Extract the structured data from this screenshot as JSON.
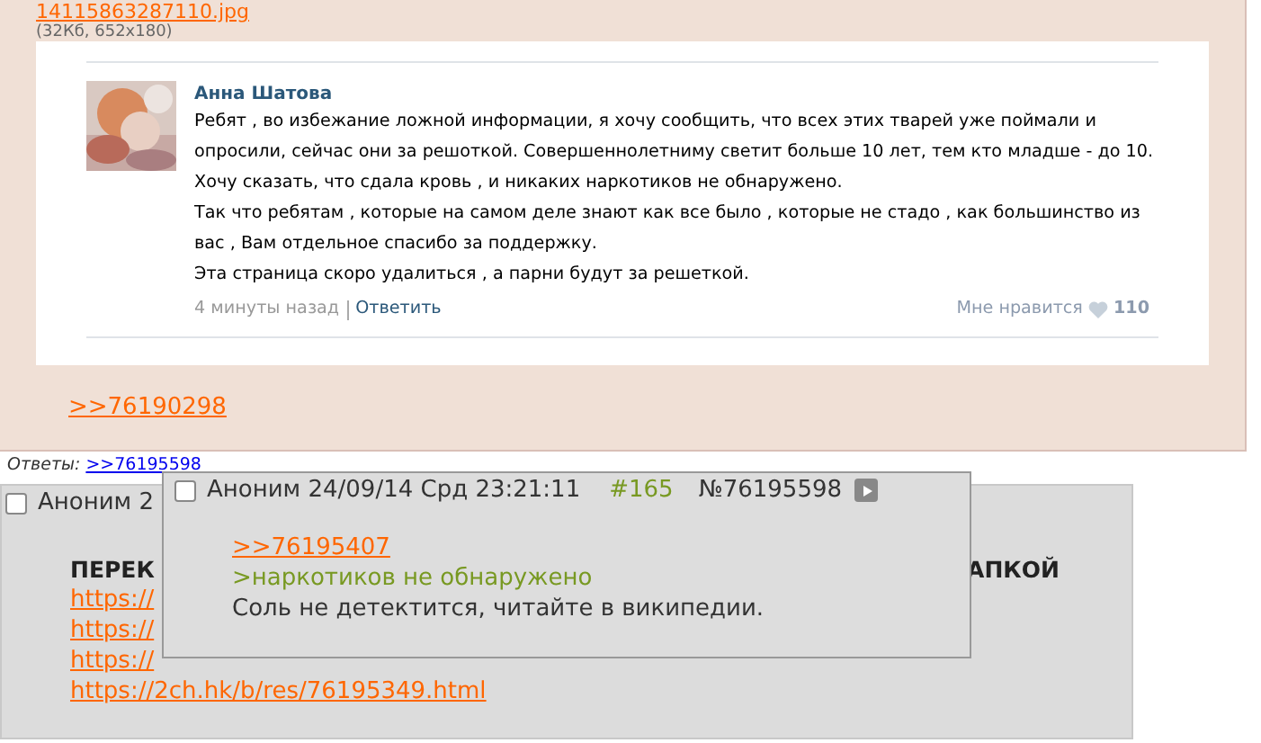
{
  "post": {
    "file_link": "14115863287110.jpg",
    "file_info": "(32Кб, 652x180)",
    "embedded_comment": {
      "author": "Анна Шатова",
      "paragraphs": [
        "Ребят , во избежание ложной информации, я хочу сообщить, что всех этих тварей уже поймали и опросили, сейчас они за решоткой. Совершеннолетниму светит больше 10 лет, тем кто младше - до 10.",
        "Хочу сказать, что сдала кровь , и никаких наркотиков не обнаружено.",
        "Так что ребятам , которые на самом деле знают как все было , которые не стадо , как большинство из вас , Вам отдельное спасибо за поддержку.",
        "Эта страница скоро удалиться , а парни будут за решеткой."
      ],
      "time": "4 минуты назад",
      "reply": "Ответить",
      "like_label": "Мне нравится",
      "like_count": "110"
    },
    "reply_link": ">>76190298",
    "answers_label": "Ответы:",
    "answers": [
      ">>76195598"
    ]
  },
  "next_post": {
    "checked": false,
    "header": "Аноним 2",
    "title_left": "ПЕРЕК",
    "title_right": "АПКОЙ",
    "links": [
      "https://",
      "https://",
      "https://",
      "https://2ch.hk/b/res/76195349.html"
    ]
  },
  "popup": {
    "checked": false,
    "header": "Аноним 24/09/14 Срд 23:21:11",
    "index": "#165",
    "number": "№76195598",
    "lines": [
      {
        "kind": "link",
        "text": ">>76195407"
      },
      {
        "kind": "quote",
        "text": ">наркотиков не обнаружено"
      },
      {
        "kind": "text",
        "text": "Соль не детектится, читайте в википедии."
      }
    ]
  }
}
